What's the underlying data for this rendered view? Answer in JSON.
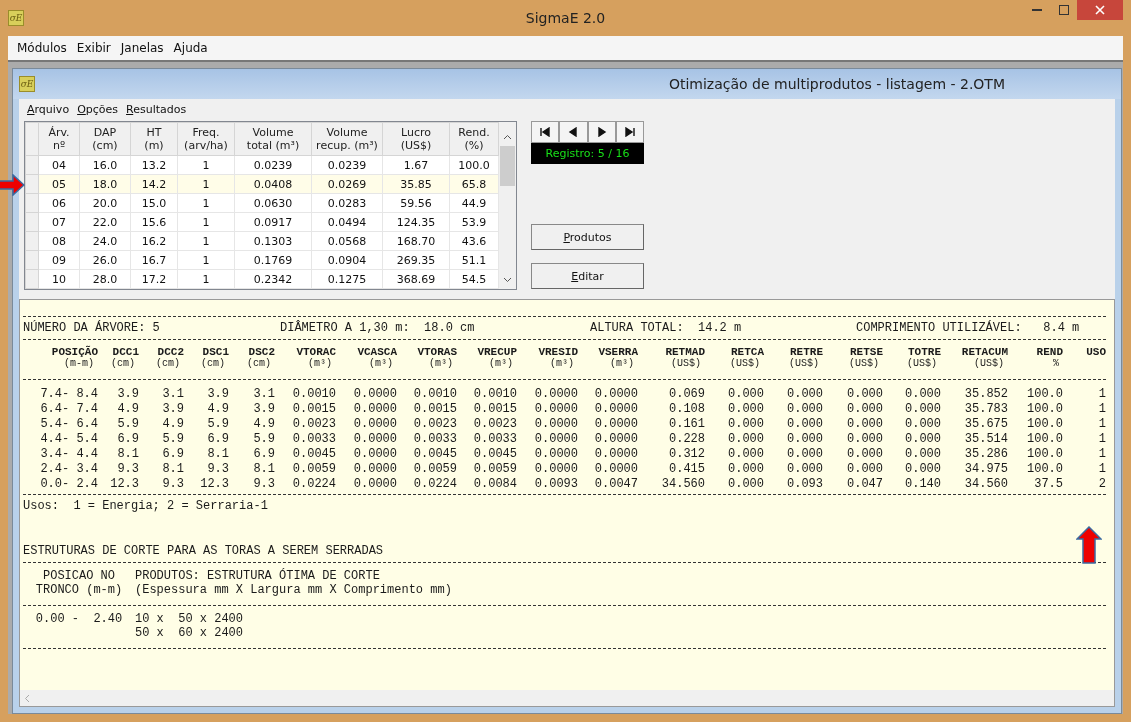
{
  "window": {
    "logo": "σE",
    "title": "SigmaE 2.0"
  },
  "menu": [
    "Módulos",
    "Exibir",
    "Janelas",
    "Ajuda"
  ],
  "child": {
    "logo": "σE",
    "title": "Otimização de multiprodutos - listagem - 2.OTM",
    "menu": [
      {
        "mnemonic": "A",
        "rest": "rquivo"
      },
      {
        "mnemonic": "O",
        "rest": "pções"
      },
      {
        "mnemonic": "R",
        "rest": "esultados"
      }
    ]
  },
  "trees": {
    "columns": [
      {
        "line1": "Árv.",
        "line2": "nº"
      },
      {
        "line1": "DAP",
        "line2": "(cm)"
      },
      {
        "line1": "HT",
        "line2": "(m)"
      },
      {
        "line1": "Freq.",
        "line2": "(arv/ha)"
      },
      {
        "line1": "Volume",
        "line2": "total  (m³)"
      },
      {
        "line1": "Volume",
        "line2": "recup. (m³)"
      },
      {
        "line1": "Lucro",
        "line2": "(US$)"
      },
      {
        "line1": "Rend.",
        "line2": "(%)"
      }
    ],
    "rows": [
      {
        "selected": false,
        "cells": [
          "04",
          "16.0",
          "13.2",
          "1",
          "0.0239",
          "0.0239",
          "1.67",
          "100.0"
        ]
      },
      {
        "selected": true,
        "cells": [
          "05",
          "18.0",
          "14.2",
          "1",
          "0.0408",
          "0.0269",
          "35.85",
          "65.8"
        ]
      },
      {
        "selected": false,
        "cells": [
          "06",
          "20.0",
          "15.0",
          "1",
          "0.0630",
          "0.0283",
          "59.56",
          "44.9"
        ]
      },
      {
        "selected": false,
        "cells": [
          "07",
          "22.0",
          "15.6",
          "1",
          "0.0917",
          "0.0494",
          "124.35",
          "53.9"
        ]
      },
      {
        "selected": false,
        "cells": [
          "08",
          "24.0",
          "16.2",
          "1",
          "0.1303",
          "0.0568",
          "168.70",
          "43.6"
        ]
      },
      {
        "selected": false,
        "cells": [
          "09",
          "26.0",
          "16.7",
          "1",
          "0.1769",
          "0.0904",
          "269.35",
          "51.1"
        ]
      },
      {
        "selected": false,
        "cells": [
          "10",
          "28.0",
          "17.2",
          "1",
          "0.2342",
          "0.1275",
          "368.69",
          "54.5"
        ]
      }
    ]
  },
  "record": "Registro: 5 / 16",
  "buttons": [
    {
      "mnemonic": "P",
      "rest": "rodutos"
    },
    {
      "mnemonic": "E",
      "rest": "ditar"
    }
  ],
  "report": {
    "summary": [
      "NÚMERO DA ÁRVORE: 5",
      "DIÂMETRO A 1,30 m:  18.0 cm",
      "ALTURA TOTAL:  14.2 m",
      "COMPRIMENTO UTILIZÁVEL:   8.4 m"
    ],
    "columns": [
      {
        "name": "POSIÇÃO",
        "unit": "(m-m)"
      },
      {
        "name": "DCC1",
        "unit": "(cm)"
      },
      {
        "name": "DCC2",
        "unit": "(cm)"
      },
      {
        "name": "DSC1",
        "unit": "(cm)"
      },
      {
        "name": "DSC2",
        "unit": "(cm)"
      },
      {
        "name": "VTORAC",
        "unit": "(m³)"
      },
      {
        "name": "VCASCA",
        "unit": "(m³)"
      },
      {
        "name": "VTORAS",
        "unit": "(m³)"
      },
      {
        "name": "VRECUP",
        "unit": "(m³)"
      },
      {
        "name": "VRESID",
        "unit": "(m³)"
      },
      {
        "name": "VSERRA",
        "unit": "(m³)"
      },
      {
        "name": "RETMAD",
        "unit": "(US$)"
      },
      {
        "name": "RETCA",
        "unit": "(US$)"
      },
      {
        "name": "RETRE",
        "unit": "(US$)"
      },
      {
        "name": "RETSE",
        "unit": "(US$)"
      },
      {
        "name": "TOTRE",
        "unit": "(US$)"
      },
      {
        "name": "RETACUM",
        "unit": "(US$)"
      },
      {
        "name": "REND",
        "unit": "%"
      },
      {
        "name": "USO"
      }
    ],
    "rows": [
      [
        "7.4- 8.4",
        "3.9",
        "3.1",
        "3.9",
        "3.1",
        "0.0010",
        "0.0000",
        "0.0010",
        "0.0010",
        "0.0000",
        "0.0000",
        "0.069",
        "0.000",
        "0.000",
        "0.000",
        "0.000",
        "35.852",
        "100.0",
        "1"
      ],
      [
        "6.4- 7.4",
        "4.9",
        "3.9",
        "4.9",
        "3.9",
        "0.0015",
        "0.0000",
        "0.0015",
        "0.0015",
        "0.0000",
        "0.0000",
        "0.108",
        "0.000",
        "0.000",
        "0.000",
        "0.000",
        "35.783",
        "100.0",
        "1"
      ],
      [
        "5.4- 6.4",
        "5.9",
        "4.9",
        "5.9",
        "4.9",
        "0.0023",
        "0.0000",
        "0.0023",
        "0.0023",
        "0.0000",
        "0.0000",
        "0.161",
        "0.000",
        "0.000",
        "0.000",
        "0.000",
        "35.675",
        "100.0",
        "1"
      ],
      [
        "4.4- 5.4",
        "6.9",
        "5.9",
        "6.9",
        "5.9",
        "0.0033",
        "0.0000",
        "0.0033",
        "0.0033",
        "0.0000",
        "0.0000",
        "0.228",
        "0.000",
        "0.000",
        "0.000",
        "0.000",
        "35.514",
        "100.0",
        "1"
      ],
      [
        "3.4- 4.4",
        "8.1",
        "6.9",
        "8.1",
        "6.9",
        "0.0045",
        "0.0000",
        "0.0045",
        "0.0045",
        "0.0000",
        "0.0000",
        "0.312",
        "0.000",
        "0.000",
        "0.000",
        "0.000",
        "35.286",
        "100.0",
        "1"
      ],
      [
        "2.4- 3.4",
        "9.3",
        "8.1",
        "9.3",
        "8.1",
        "0.0059",
        "0.0000",
        "0.0059",
        "0.0059",
        "0.0000",
        "0.0000",
        "0.415",
        "0.000",
        "0.000",
        "0.000",
        "0.000",
        "34.975",
        "100.0",
        "1"
      ],
      [
        "0.0- 2.4",
        "12.3",
        "9.3",
        "12.3",
        "9.3",
        "0.0224",
        "0.0000",
        "0.0224",
        "0.0084",
        "0.0093",
        "0.0047",
        "34.560",
        "0.000",
        "0.093",
        "0.047",
        "0.140",
        "34.560",
        "37.5",
        "2"
      ]
    ],
    "legend": "Usos:  1 = Energia; 2 = Serraria-1",
    "section_title": "ESTRUTURAS DE CORTE PARA AS TORAS A SEREM SERRADAS",
    "cut_header": {
      "position": [
        "POSICAO NO",
        "TRONCO (m-m)"
      ],
      "products": [
        "PRODUTOS: ESTRUTURA ÓTIMA DE CORTE",
        "(Espessura mm X Largura mm X Comprimento mm)"
      ]
    },
    "cuts": [
      {
        "position": "0.00 -  2.40",
        "products": [
          "10 x  50 x 2400",
          "50 x  60 x 2400"
        ]
      }
    ]
  }
}
